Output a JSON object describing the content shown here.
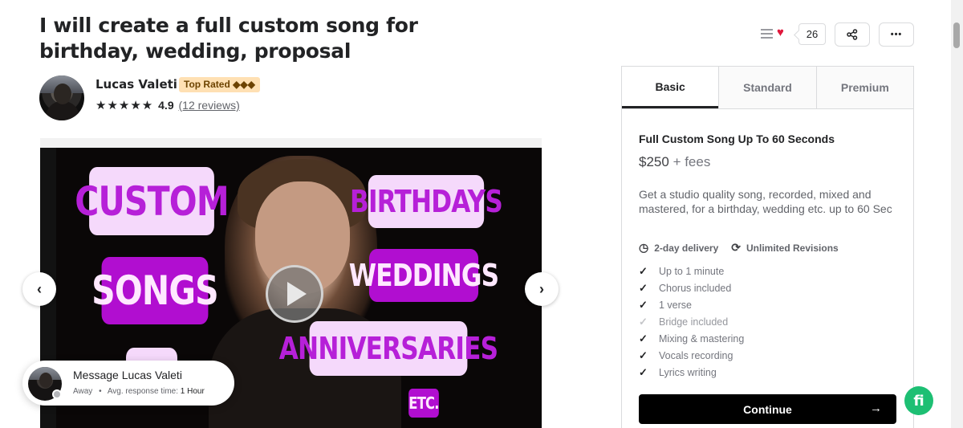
{
  "gig": {
    "title": "I will create a full custom song for birthday, wedding, proposal"
  },
  "seller": {
    "name": "Lucas Valeti",
    "badge": "Top Rated ◆◆◆",
    "stars": "★★★★★",
    "rating": "4.9",
    "reviews": "(12 reviews)"
  },
  "media": {
    "labels": {
      "custom": "CUSTOM",
      "songs": "SONGS",
      "birthdays": "BIRTHDAYS",
      "weddings": "WEDDINGS",
      "anniversaries": "ANNIVERSARIES",
      "etc": "ETC."
    },
    "prev_icon": "chevron-left-icon",
    "next_icon": "chevron-right-icon",
    "play_icon": "play-icon"
  },
  "message": {
    "title": "Message Lucas Valeti",
    "status": "Away",
    "separator": "•",
    "response_label": "Avg. response time:",
    "response_value": "1 Hour"
  },
  "actions": {
    "save_count": "26",
    "more": "•••"
  },
  "package": {
    "tabs": [
      "Basic",
      "Standard",
      "Premium"
    ],
    "active_tab": "Basic",
    "title": "Full Custom Song Up To 60 Seconds",
    "price": "$250",
    "fees": "+ fees",
    "description": "Get a studio quality song, recorded, mixed and mastered, for a birthday, wedding etc. up to 60 Sec",
    "delivery": "2-day delivery",
    "revisions": "Unlimited Revisions",
    "features": [
      {
        "label": "Up to 1 minute",
        "included": true
      },
      {
        "label": "Chorus included",
        "included": true
      },
      {
        "label": "1 verse",
        "included": true
      },
      {
        "label": "Bridge included",
        "included": false
      },
      {
        "label": "Mixing & mastering",
        "included": true
      },
      {
        "label": "Vocals recording",
        "included": true
      },
      {
        "label": "Lyrics writing",
        "included": true
      }
    ],
    "continue_label": "Continue",
    "continue_arrow": "→"
  },
  "fab": {
    "label": "fi"
  },
  "colors": {
    "accent_green": "#1dbf73",
    "heart_red": "#e0183c",
    "badge_bg": "#ffe0b3",
    "pill_purple": "#b10ed0",
    "pill_pink": "#f5d9fb"
  }
}
